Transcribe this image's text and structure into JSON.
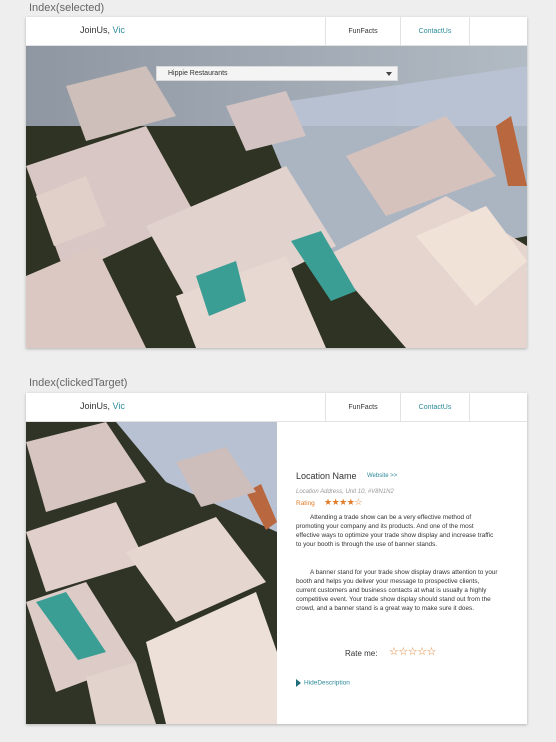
{
  "frames": [
    {
      "label": "Index(selected)",
      "nav": {
        "brand_prefix": "JoinUs,",
        "brand_user": "Vic",
        "items": [
          "FunFacts",
          "ContactUs"
        ]
      },
      "dropdown": {
        "selected": "Hippie Restaurants"
      }
    },
    {
      "label": "Index(clickedTarget)",
      "nav": {
        "brand_prefix": "JoinUs,",
        "brand_user": "Vic",
        "items": [
          "FunFacts",
          "ContactUs"
        ]
      },
      "panel": {
        "title": "Location Name",
        "website": "Website >>",
        "address": "Location Address, Unit 10, #V8N1N2",
        "rating_label": "Rating",
        "rating": 4,
        "rating_max": 5,
        "paragraph_1": "Attending a trade show can be a very effective method of promoting your company and its products. And one of the most effective ways to optimize your trade show display and increase traffic to your booth is through the use of banner stands.",
        "paragraph_2": "A banner stand for your trade show display draws attention to your booth and helps you deliver your message to prospective clients, current customers and business contacts at what is usually a highly competitive event. Your trade show display should stand out from the crowd, and a banner stand is a great way to make sure it does.",
        "rate_me": "Rate me:",
        "hide_description": "HideDescription"
      }
    }
  ],
  "colors": {
    "accent": "#2c8a99",
    "star": "#e07b28",
    "map_highlight": "#3a9e95"
  }
}
